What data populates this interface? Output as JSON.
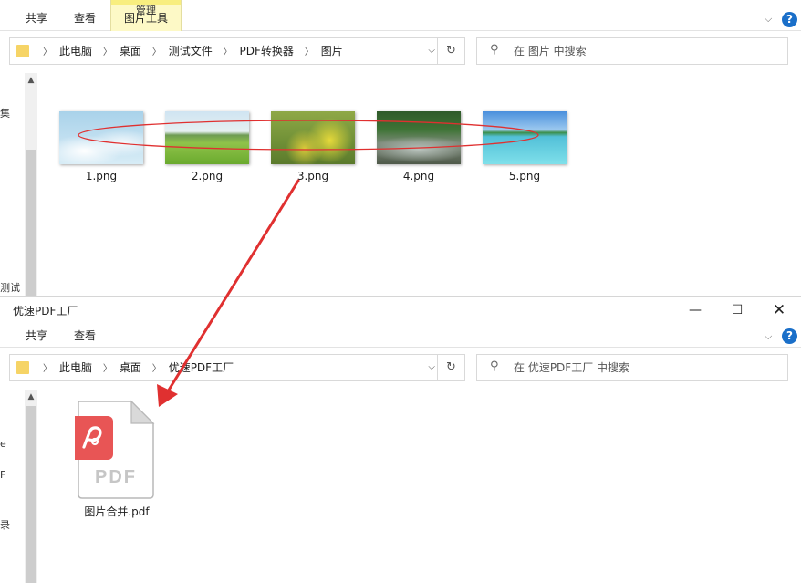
{
  "top_window": {
    "ribbon": {
      "tabs": [
        "共享",
        "查看",
        "图片工具"
      ],
      "tools_caption": "管理"
    },
    "breadcrumb": [
      "此电脑",
      "桌面",
      "测试文件",
      "PDF转换器",
      "图片"
    ],
    "search_placeholder": "在 图片 中搜索",
    "nav_edge_texts": [
      "集",
      "测试"
    ],
    "files": [
      {
        "name": "1.png",
        "scene": "sky-clouds"
      },
      {
        "name": "2.png",
        "scene": "green-field"
      },
      {
        "name": "3.png",
        "scene": "yellow-flowers"
      },
      {
        "name": "4.png",
        "scene": "forest-stream"
      },
      {
        "name": "5.png",
        "scene": "sea-beach"
      }
    ]
  },
  "bottom_window": {
    "title": "优速PDF工厂",
    "ribbon": {
      "tabs": [
        "共享",
        "查看"
      ]
    },
    "breadcrumb": [
      "此电脑",
      "桌面",
      "优速PDF工厂"
    ],
    "search_placeholder": "在 优速PDF工厂 中搜索",
    "nav_edge_texts": [
      "e",
      "F",
      "录"
    ],
    "file": {
      "name": "图片合并.pdf",
      "icon_text": "PDF"
    }
  },
  "colors": {
    "annotation_red": "#e03030",
    "pdf_badge": "#e85555",
    "folder": "#f6d466",
    "help_blue": "#1a6fc9"
  }
}
